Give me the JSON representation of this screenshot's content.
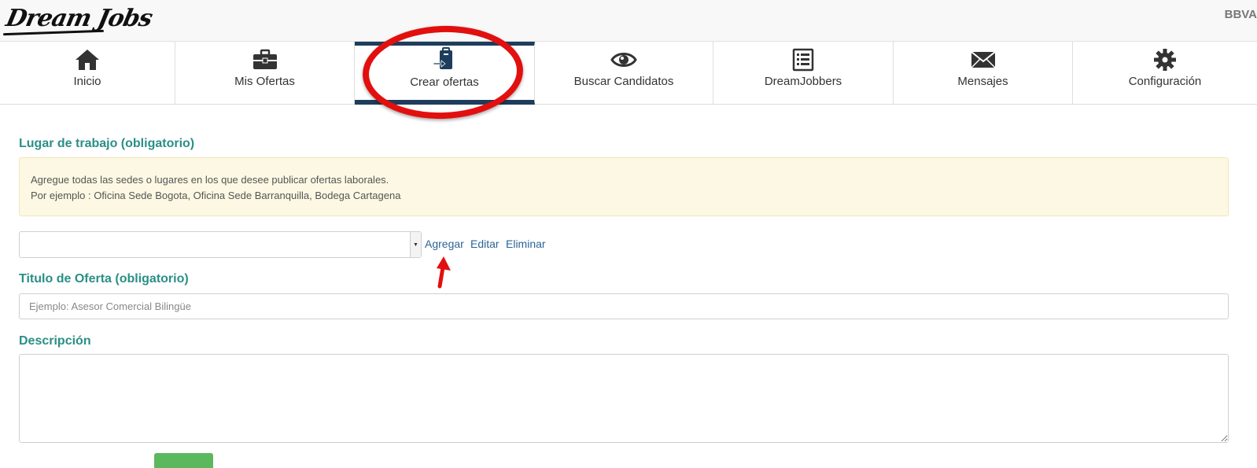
{
  "header": {
    "logo_text": "Dream Jobs",
    "account_label": "BBVA"
  },
  "nav": {
    "items": [
      {
        "label": "Inicio",
        "icon": "home-icon"
      },
      {
        "label": "Mis Ofertas",
        "icon": "briefcase-icon"
      },
      {
        "label": "Crear ofertas",
        "icon": "create-offer-icon",
        "active": true
      },
      {
        "label": "Buscar Candidatos",
        "icon": "eye-icon"
      },
      {
        "label": "DreamJobbers",
        "icon": "list-icon"
      },
      {
        "label": "Mensajes",
        "icon": "envelope-icon"
      },
      {
        "label": "Configuración",
        "icon": "gear-icon"
      }
    ],
    "active_color": "#1e3d5c"
  },
  "form": {
    "workplace": {
      "title": "Lugar de trabajo (obligatorio)",
      "info_line1": "Agregue todas las sedes o lugares en los que desee publicar ofertas laborales.",
      "info_line2": "Por ejemplo : Oficina Sede Bogota, Oficina Sede Barranquilla, Bodega Cartagena",
      "selected_value": "",
      "add_label": "Agregar",
      "edit_label": "Editar",
      "delete_label": "Eliminar"
    },
    "offer_title": {
      "title": "Titulo de Oferta (obligatorio)",
      "placeholder": "Ejemplo: Asesor Comercial Bilingüe",
      "value": ""
    },
    "description": {
      "title": "Descripción",
      "value": ""
    }
  },
  "colors": {
    "section_title": "#2a8f86",
    "link": "#2a6496",
    "alert_bg": "#fcf8e3",
    "annotation": "#e20f0f",
    "button_green": "#5cb85c"
  }
}
